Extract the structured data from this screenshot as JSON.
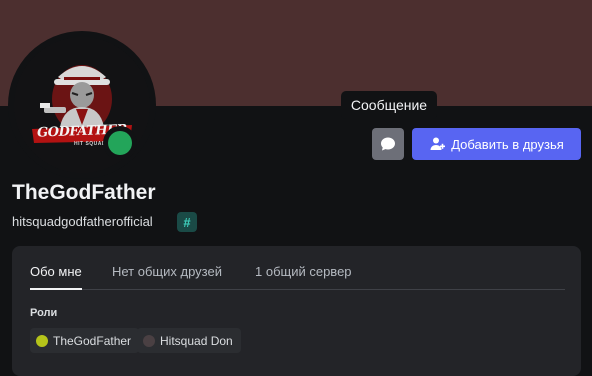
{
  "tooltip": {
    "text": "Сообщение"
  },
  "actions": {
    "add_friend_label": "Добавить в друзья"
  },
  "profile": {
    "display_name": "TheGodFather",
    "username": "hitsquadgodfatherofficial",
    "badge_symbol": "#",
    "avatar_logo_text": "GODFATHER",
    "avatar_logo_subtext": "HIT SQUAD",
    "status": "online"
  },
  "tabs": [
    {
      "label": "Обо мне",
      "active": true
    },
    {
      "label": "Нет общих друзей",
      "active": false
    },
    {
      "label": "1 общий сервер",
      "active": false
    }
  ],
  "roles": {
    "title": "Роли",
    "items": [
      {
        "name": "TheGodFather",
        "color": "#b5c41a"
      },
      {
        "name": "Hitsquad Don",
        "color": "#4a4043"
      }
    ]
  },
  "colors": {
    "banner": "#4c2f2f",
    "accent": "#5865f2",
    "online": "#23a55a"
  }
}
